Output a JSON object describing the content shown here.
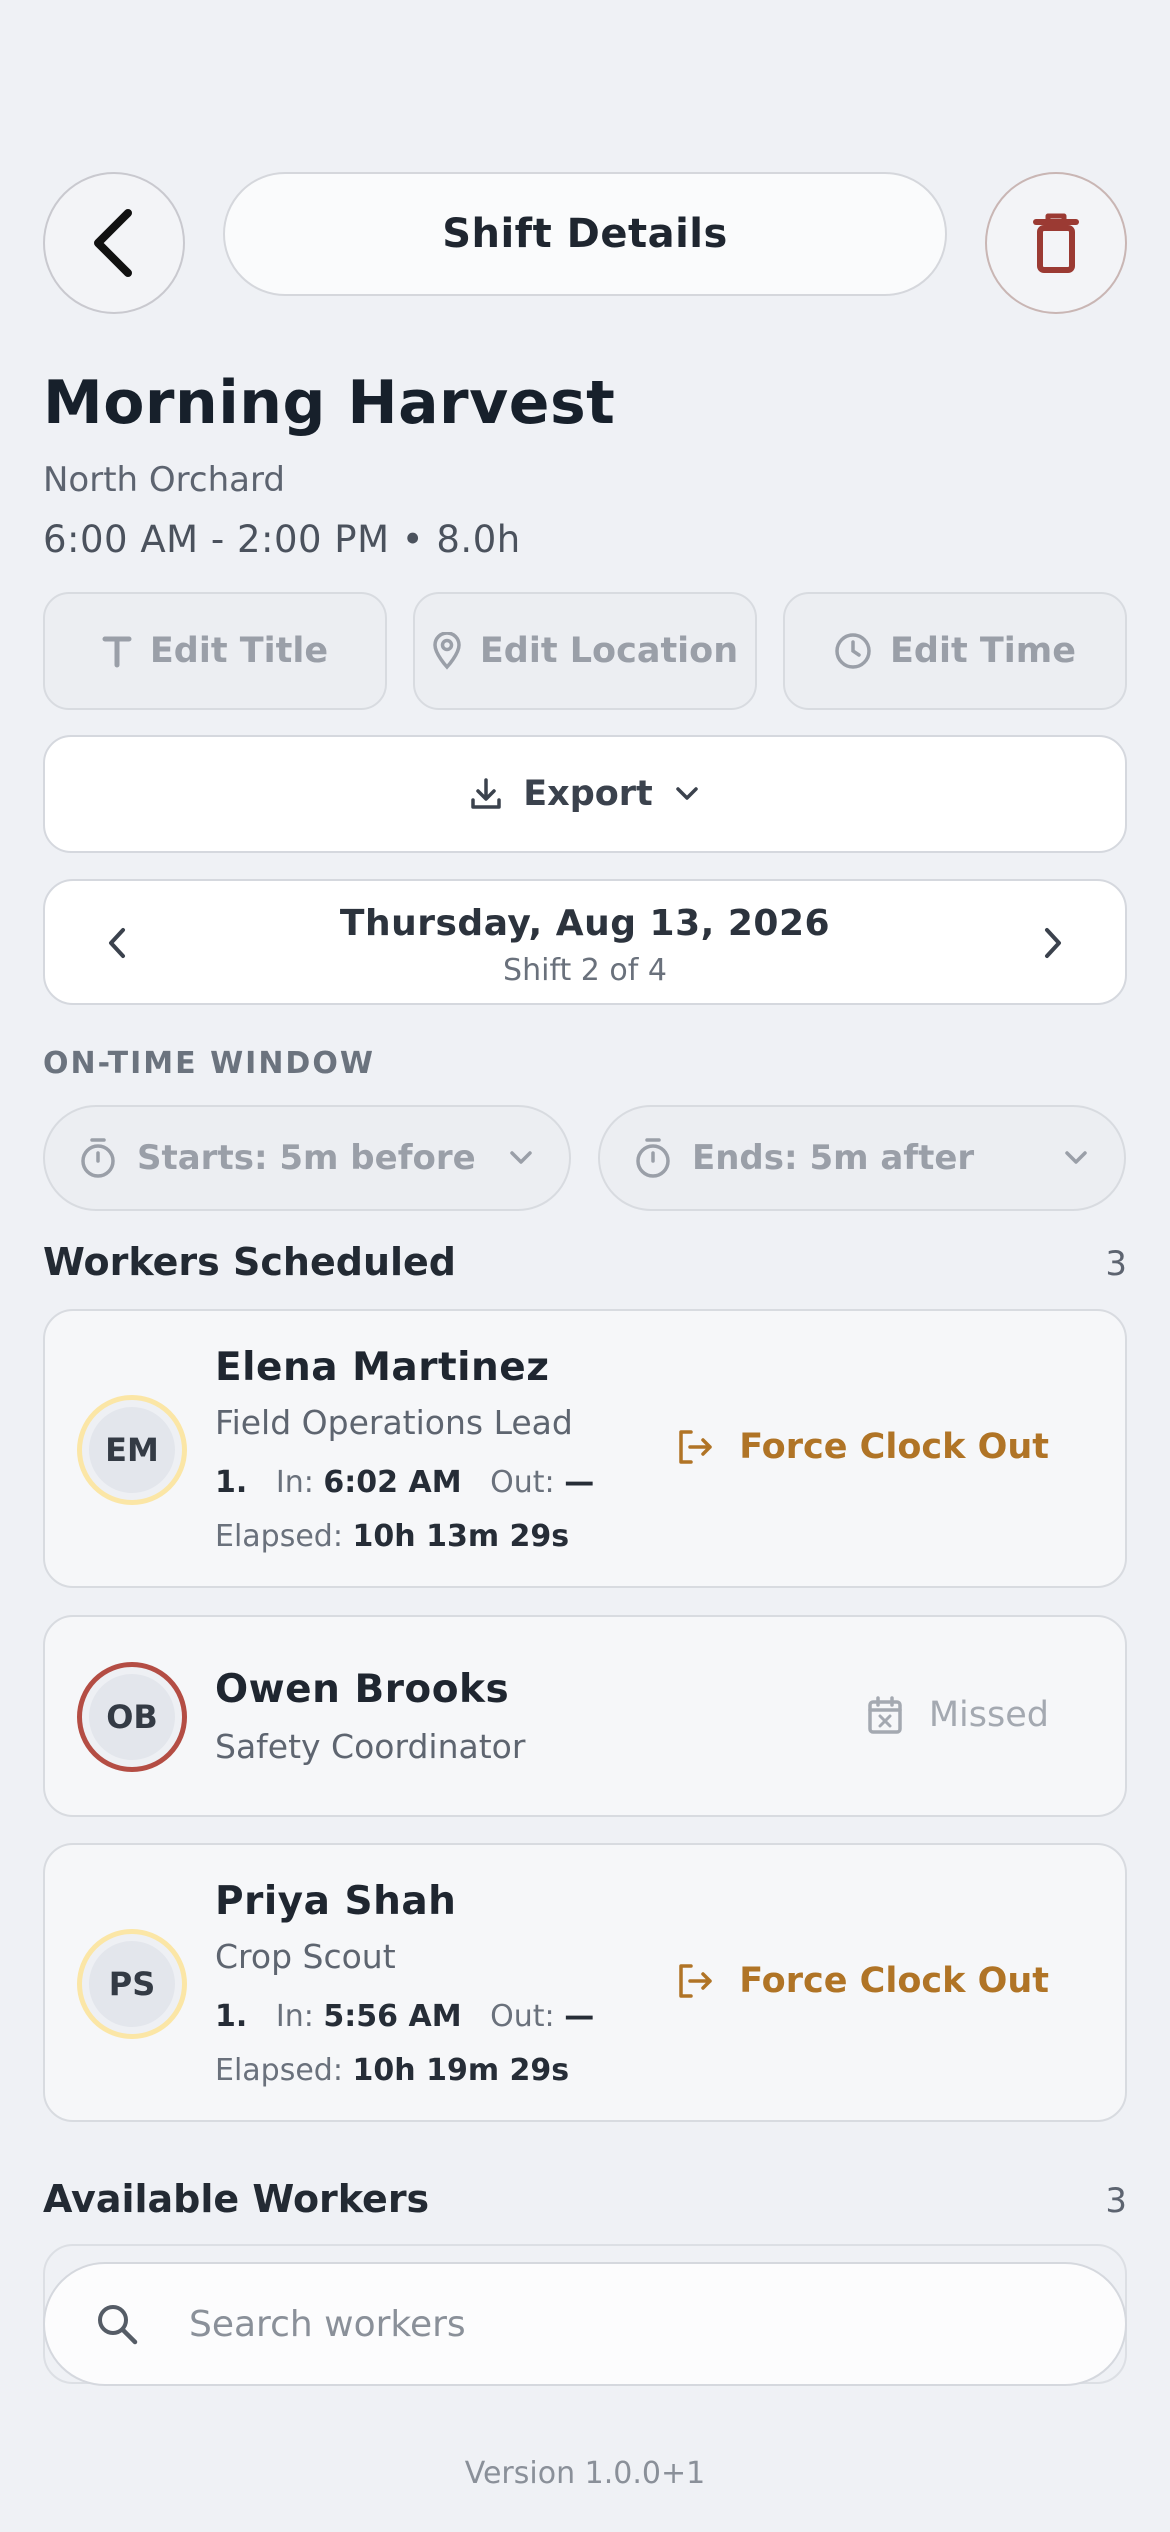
{
  "header": {
    "title": "Shift Details"
  },
  "shift": {
    "name": "Morning Harvest",
    "location": "North Orchard",
    "time": "6:00 AM - 2:00 PM • 8.0h"
  },
  "edit_actions": {
    "title": "Edit Title",
    "location": "Edit Location",
    "time": "Edit Time"
  },
  "export_label": "Export",
  "date_nav": {
    "date": "Thursday, Aug 13, 2026",
    "sub": "Shift 2 of 4"
  },
  "on_time_window": {
    "heading": "ON-TIME WINDOW",
    "starts": "Starts: 5m before",
    "ends": "Ends: 5m after"
  },
  "workers_scheduled": {
    "heading": "Workers Scheduled",
    "count": "3",
    "workers": [
      {
        "initials": "EM",
        "name": "Elena Martinez",
        "role": "Field Operations Lead",
        "index": "1.",
        "in_label": "In:",
        "in_time": "6:02 AM",
        "out_label": "Out:",
        "out_time": "—",
        "elapsed_label": "Elapsed:",
        "elapsed": "10h 13m 29s",
        "action": "Force Clock Out"
      },
      {
        "initials": "OB",
        "name": "Owen Brooks",
        "role": "Safety Coordinator",
        "status": "Missed"
      },
      {
        "initials": "PS",
        "name": "Priya Shah",
        "role": "Crop Scout",
        "index": "1.",
        "in_label": "In:",
        "in_time": "5:56 AM",
        "out_label": "Out:",
        "out_time": "—",
        "elapsed_label": "Elapsed:",
        "elapsed": "10h 19m 29s",
        "action": "Force Clock Out"
      }
    ]
  },
  "available_workers": {
    "heading": "Available Workers",
    "count": "3",
    "search_placeholder": "Search workers"
  },
  "version": "Version 1.0.0+1",
  "colors": {
    "background": "#eff1f5",
    "accent_warning": "#b07426",
    "danger": "#9b3a33",
    "missed_ring": "#b44d44",
    "clocked_in_ring": "#fbe6a6"
  }
}
